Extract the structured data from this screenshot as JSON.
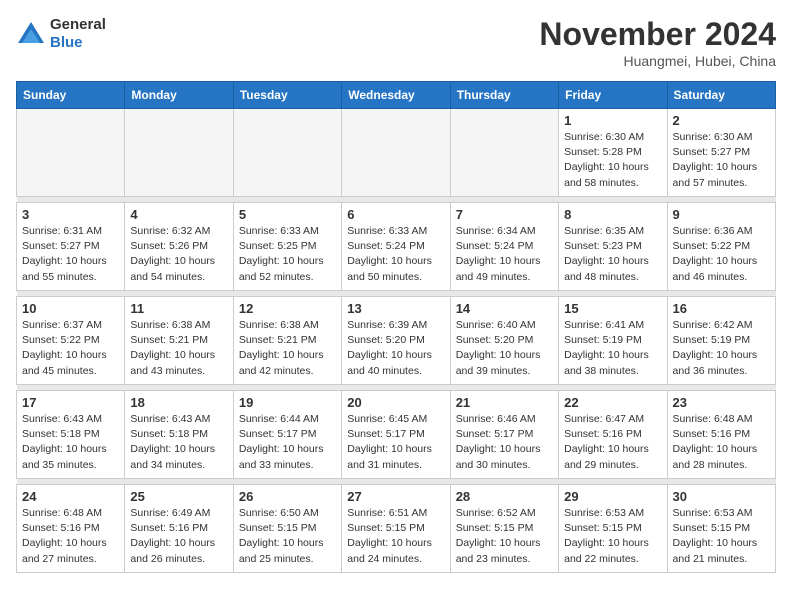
{
  "logo": {
    "general": "General",
    "blue": "Blue"
  },
  "title": "November 2024",
  "location": "Huangmei, Hubei, China",
  "headers": [
    "Sunday",
    "Monday",
    "Tuesday",
    "Wednesday",
    "Thursday",
    "Friday",
    "Saturday"
  ],
  "weeks": [
    [
      {
        "day": "",
        "info": ""
      },
      {
        "day": "",
        "info": ""
      },
      {
        "day": "",
        "info": ""
      },
      {
        "day": "",
        "info": ""
      },
      {
        "day": "",
        "info": ""
      },
      {
        "day": "1",
        "info": "Sunrise: 6:30 AM\nSunset: 5:28 PM\nDaylight: 10 hours\nand 58 minutes."
      },
      {
        "day": "2",
        "info": "Sunrise: 6:30 AM\nSunset: 5:27 PM\nDaylight: 10 hours\nand 57 minutes."
      }
    ],
    [
      {
        "day": "3",
        "info": "Sunrise: 6:31 AM\nSunset: 5:27 PM\nDaylight: 10 hours\nand 55 minutes."
      },
      {
        "day": "4",
        "info": "Sunrise: 6:32 AM\nSunset: 5:26 PM\nDaylight: 10 hours\nand 54 minutes."
      },
      {
        "day": "5",
        "info": "Sunrise: 6:33 AM\nSunset: 5:25 PM\nDaylight: 10 hours\nand 52 minutes."
      },
      {
        "day": "6",
        "info": "Sunrise: 6:33 AM\nSunset: 5:24 PM\nDaylight: 10 hours\nand 50 minutes."
      },
      {
        "day": "7",
        "info": "Sunrise: 6:34 AM\nSunset: 5:24 PM\nDaylight: 10 hours\nand 49 minutes."
      },
      {
        "day": "8",
        "info": "Sunrise: 6:35 AM\nSunset: 5:23 PM\nDaylight: 10 hours\nand 48 minutes."
      },
      {
        "day": "9",
        "info": "Sunrise: 6:36 AM\nSunset: 5:22 PM\nDaylight: 10 hours\nand 46 minutes."
      }
    ],
    [
      {
        "day": "10",
        "info": "Sunrise: 6:37 AM\nSunset: 5:22 PM\nDaylight: 10 hours\nand 45 minutes."
      },
      {
        "day": "11",
        "info": "Sunrise: 6:38 AM\nSunset: 5:21 PM\nDaylight: 10 hours\nand 43 minutes."
      },
      {
        "day": "12",
        "info": "Sunrise: 6:38 AM\nSunset: 5:21 PM\nDaylight: 10 hours\nand 42 minutes."
      },
      {
        "day": "13",
        "info": "Sunrise: 6:39 AM\nSunset: 5:20 PM\nDaylight: 10 hours\nand 40 minutes."
      },
      {
        "day": "14",
        "info": "Sunrise: 6:40 AM\nSunset: 5:20 PM\nDaylight: 10 hours\nand 39 minutes."
      },
      {
        "day": "15",
        "info": "Sunrise: 6:41 AM\nSunset: 5:19 PM\nDaylight: 10 hours\nand 38 minutes."
      },
      {
        "day": "16",
        "info": "Sunrise: 6:42 AM\nSunset: 5:19 PM\nDaylight: 10 hours\nand 36 minutes."
      }
    ],
    [
      {
        "day": "17",
        "info": "Sunrise: 6:43 AM\nSunset: 5:18 PM\nDaylight: 10 hours\nand 35 minutes."
      },
      {
        "day": "18",
        "info": "Sunrise: 6:43 AM\nSunset: 5:18 PM\nDaylight: 10 hours\nand 34 minutes."
      },
      {
        "day": "19",
        "info": "Sunrise: 6:44 AM\nSunset: 5:17 PM\nDaylight: 10 hours\nand 33 minutes."
      },
      {
        "day": "20",
        "info": "Sunrise: 6:45 AM\nSunset: 5:17 PM\nDaylight: 10 hours\nand 31 minutes."
      },
      {
        "day": "21",
        "info": "Sunrise: 6:46 AM\nSunset: 5:17 PM\nDaylight: 10 hours\nand 30 minutes."
      },
      {
        "day": "22",
        "info": "Sunrise: 6:47 AM\nSunset: 5:16 PM\nDaylight: 10 hours\nand 29 minutes."
      },
      {
        "day": "23",
        "info": "Sunrise: 6:48 AM\nSunset: 5:16 PM\nDaylight: 10 hours\nand 28 minutes."
      }
    ],
    [
      {
        "day": "24",
        "info": "Sunrise: 6:48 AM\nSunset: 5:16 PM\nDaylight: 10 hours\nand 27 minutes."
      },
      {
        "day": "25",
        "info": "Sunrise: 6:49 AM\nSunset: 5:16 PM\nDaylight: 10 hours\nand 26 minutes."
      },
      {
        "day": "26",
        "info": "Sunrise: 6:50 AM\nSunset: 5:15 PM\nDaylight: 10 hours\nand 25 minutes."
      },
      {
        "day": "27",
        "info": "Sunrise: 6:51 AM\nSunset: 5:15 PM\nDaylight: 10 hours\nand 24 minutes."
      },
      {
        "day": "28",
        "info": "Sunrise: 6:52 AM\nSunset: 5:15 PM\nDaylight: 10 hours\nand 23 minutes."
      },
      {
        "day": "29",
        "info": "Sunrise: 6:53 AM\nSunset: 5:15 PM\nDaylight: 10 hours\nand 22 minutes."
      },
      {
        "day": "30",
        "info": "Sunrise: 6:53 AM\nSunset: 5:15 PM\nDaylight: 10 hours\nand 21 minutes."
      }
    ]
  ]
}
